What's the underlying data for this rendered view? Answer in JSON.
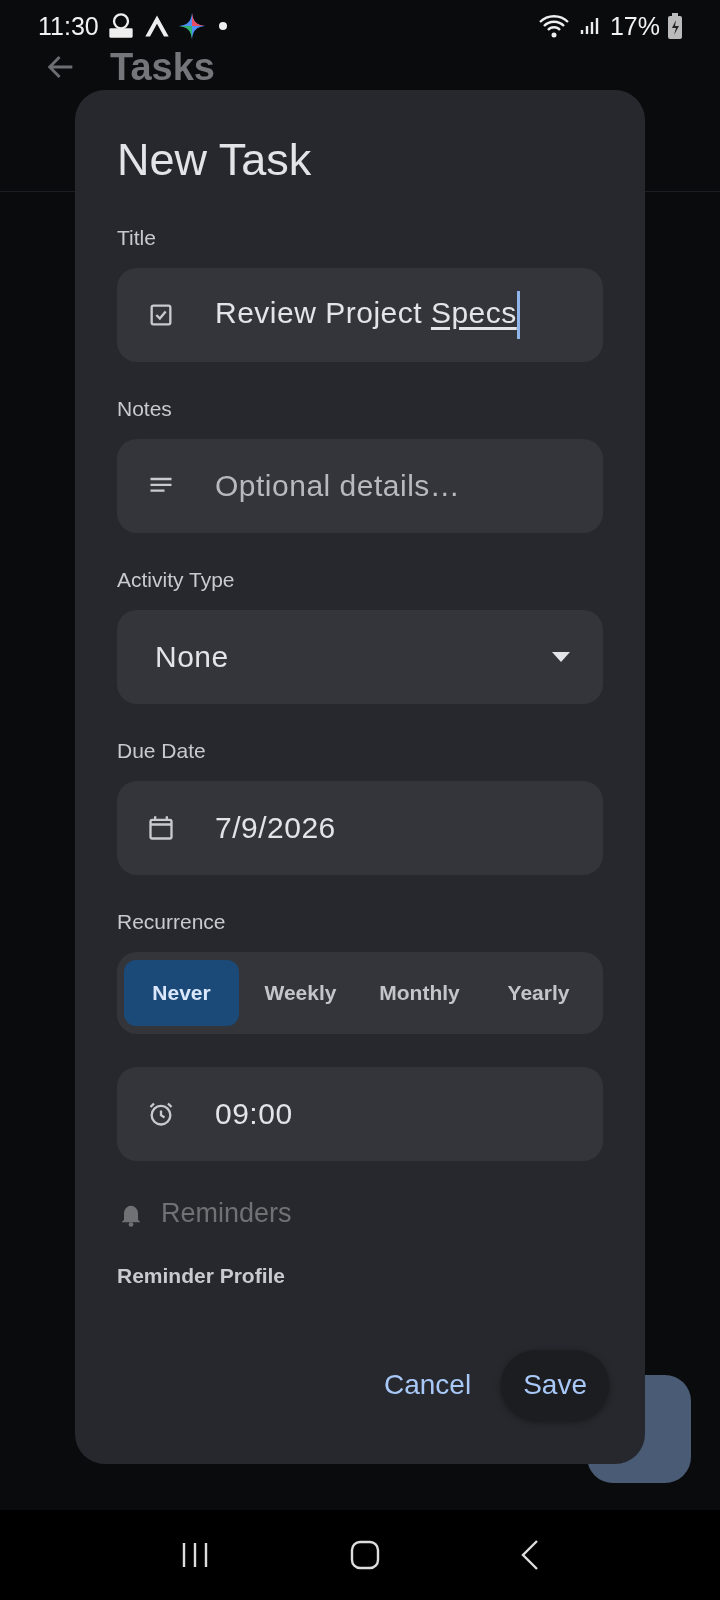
{
  "status_bar": {
    "time": "11:30",
    "battery": "17%"
  },
  "app_bar": {
    "title": "Tasks"
  },
  "dialog": {
    "title": "New Task",
    "sections": [
      {
        "kind": "text",
        "label": "Title",
        "value": "Review Project",
        "composing": "Specs",
        "focused": true
      },
      {
        "kind": "text",
        "label": "Notes",
        "placeholder": "Optional details…"
      },
      {
        "kind": "dropdown",
        "label": "Activity Type",
        "value": "None"
      },
      {
        "kind": "text",
        "label": "Due Date",
        "value": "7/9/2026"
      },
      {
        "kind": "segmented",
        "label": "Recurrence",
        "options": [
          {
            "label": "Never",
            "selected": true
          },
          {
            "label": "Weekly",
            "selected": false
          },
          {
            "label": "Monthly",
            "selected": false
          },
          {
            "label": "Yearly",
            "selected": false
          }
        ]
      },
      {
        "kind": "text",
        "value": "09:00"
      },
      {
        "kind": "heading",
        "text": "Reminders",
        "disabled": true
      },
      {
        "kind": "label",
        "label": "Reminder Profile"
      }
    ],
    "buttons": [
      {
        "label": "Cancel",
        "kind": "text"
      },
      {
        "label": "Save",
        "kind": "tonal"
      }
    ]
  }
}
